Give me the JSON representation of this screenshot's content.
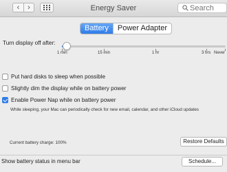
{
  "window": {
    "title": "Energy Saver"
  },
  "toolbar": {
    "back_icon": "chevron-left-icon",
    "forward_icon": "chevron-right-icon",
    "grid_icon": "grid-icon",
    "search_placeholder": "Search"
  },
  "tabs": [
    {
      "label": "Battery",
      "active": true
    },
    {
      "label": "Power Adapter",
      "active": false
    }
  ],
  "display_off": {
    "label": "Turn display off after:",
    "value_fraction": 0.03,
    "tick_labels": [
      "1 min",
      "15 min",
      "1 hr",
      "3 hrs",
      "Never"
    ]
  },
  "options": [
    {
      "label": "Put hard disks to sleep when possible",
      "checked": false
    },
    {
      "label": "Slightly dim the display while on battery power",
      "checked": false
    },
    {
      "label": "Enable Power Nap while on battery power",
      "checked": true
    }
  ],
  "power_nap_description": "While sleeping, your Mac can periodically check for new email, calendar, and other iCloud updates",
  "battery_charge": "Current battery charge: 100%",
  "restore_defaults_label": "Restore Defaults",
  "show_status_label": "Show battery status in menu bar",
  "show_status_checked": false,
  "schedule_label": "Schedule...",
  "colors": {
    "accent": "#2f7ce9",
    "background": "#ececec"
  }
}
